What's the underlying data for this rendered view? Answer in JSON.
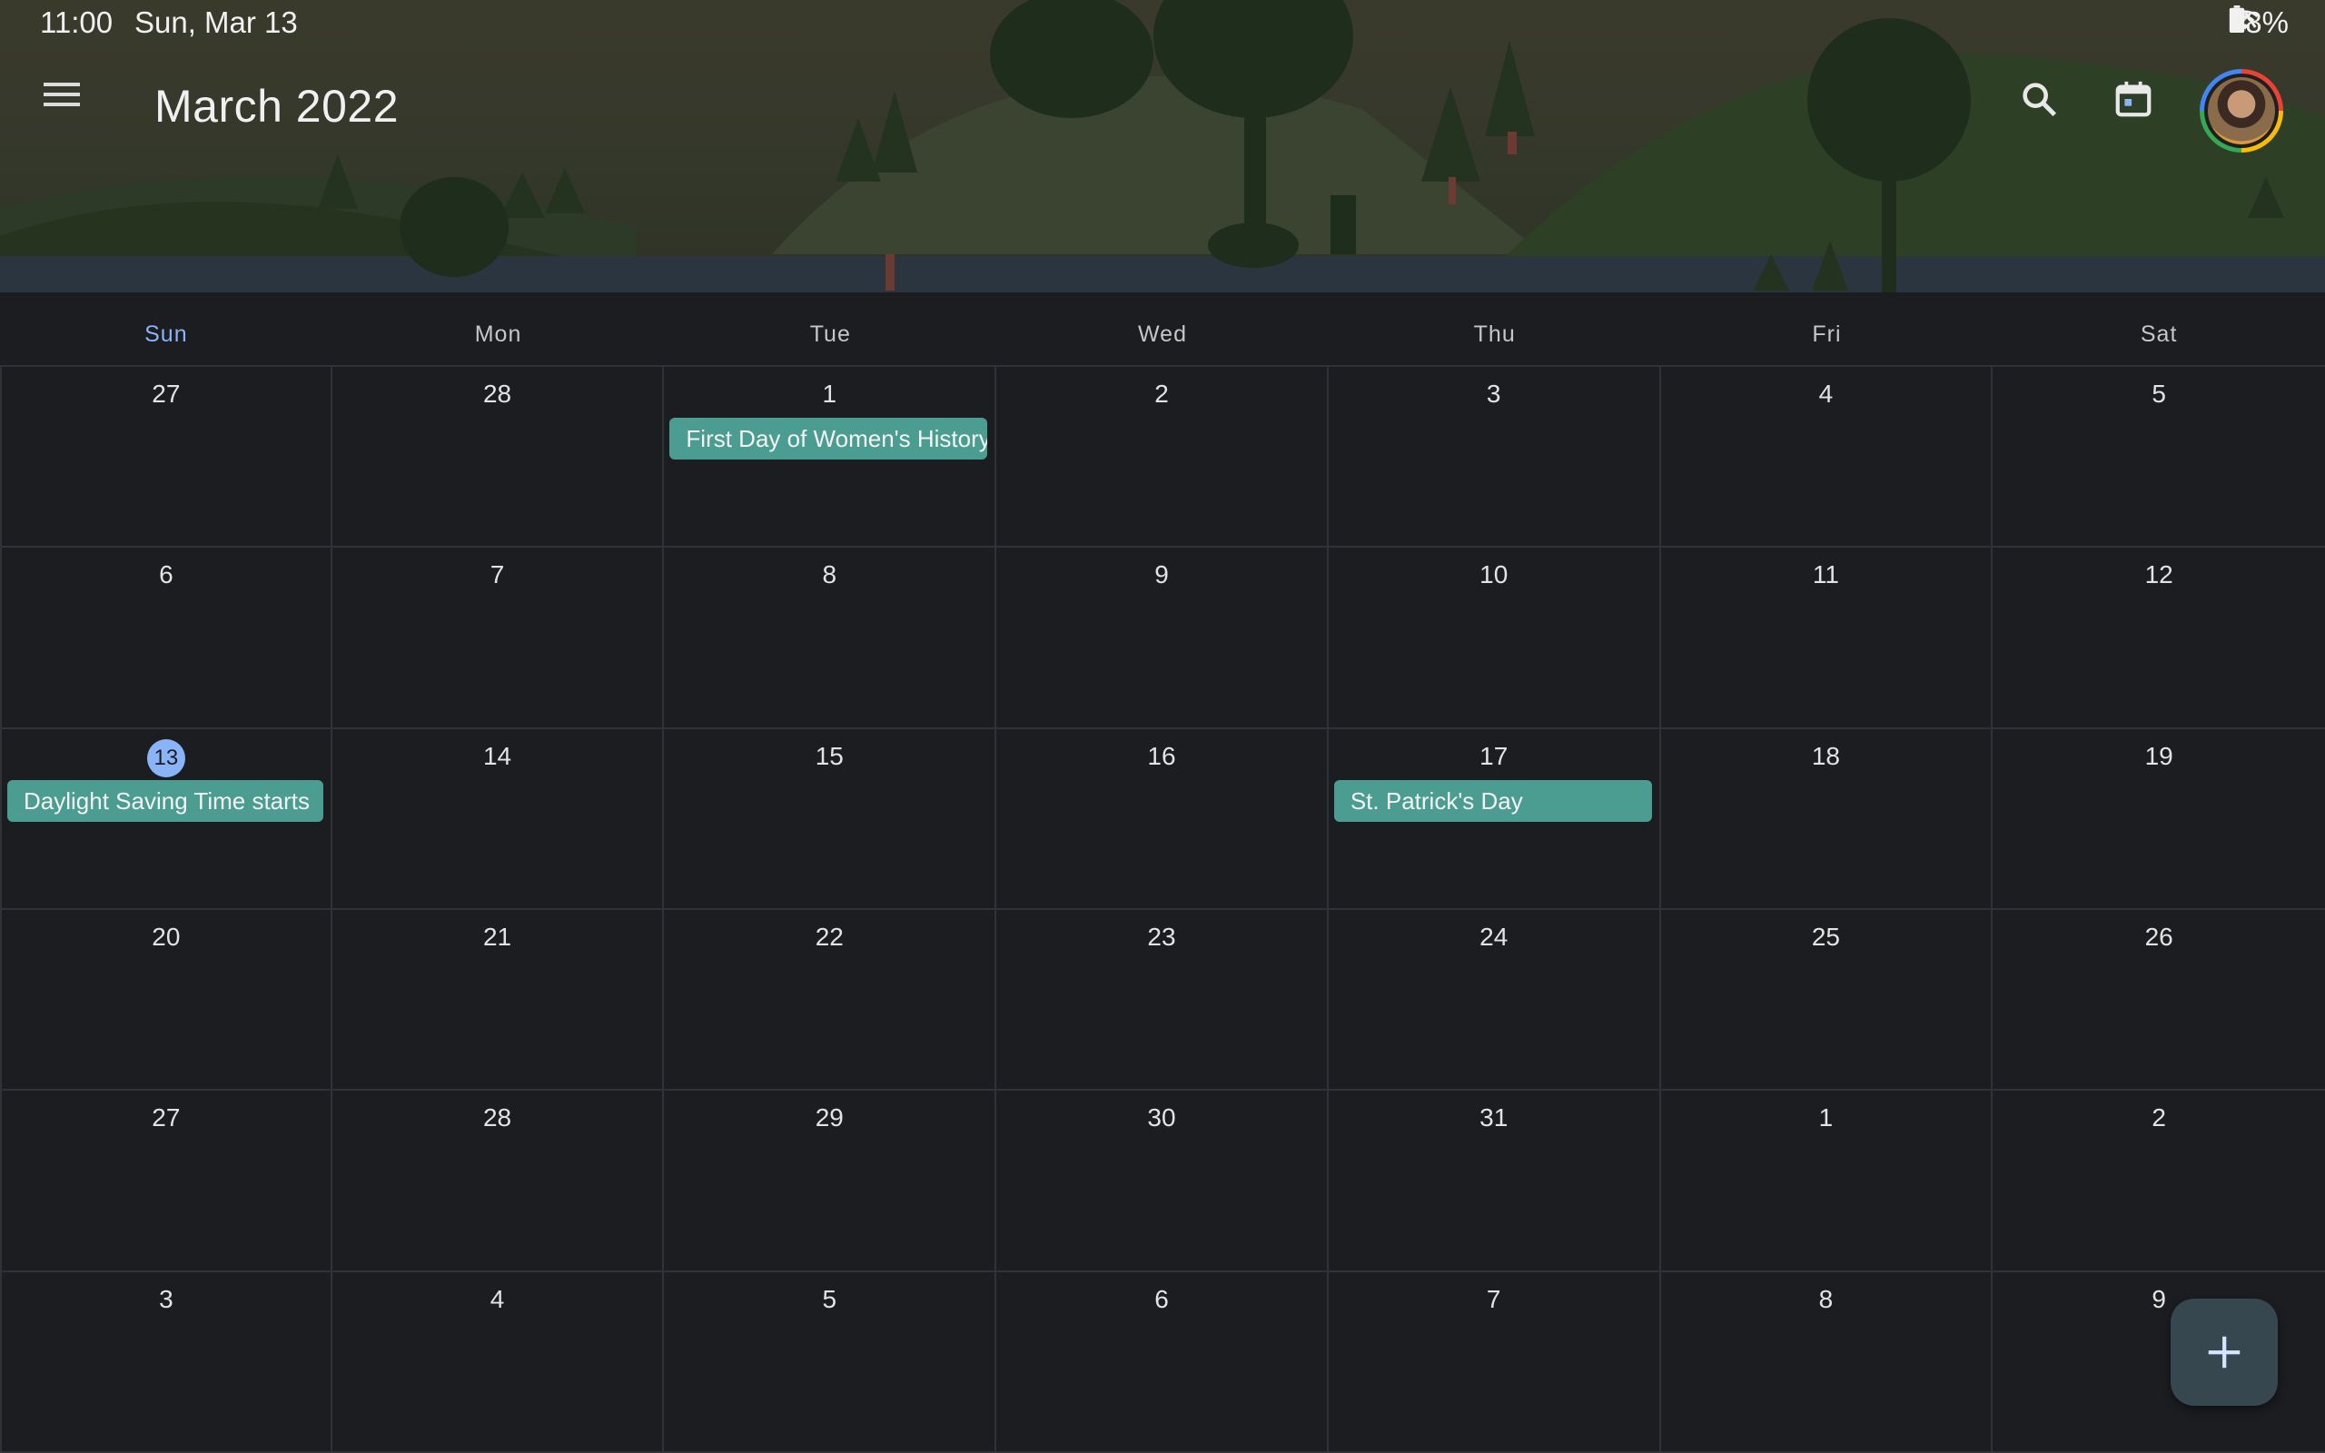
{
  "status_bar": {
    "time": "11:00",
    "date": "Sun, Mar 13",
    "battery": "78%",
    "icons": [
      "pen-icon",
      "mute-icon",
      "wifi-icon",
      "battery-icon"
    ]
  },
  "app_bar": {
    "title": "March 2022",
    "icons": [
      "menu-icon",
      "search-icon",
      "calendar-today-icon",
      "account-avatar"
    ]
  },
  "weekdays": [
    {
      "label": "Sun",
      "is_today": true
    },
    {
      "label": "Mon",
      "is_today": false
    },
    {
      "label": "Tue",
      "is_today": false
    },
    {
      "label": "Wed",
      "is_today": false
    },
    {
      "label": "Thu",
      "is_today": false
    },
    {
      "label": "Fri",
      "is_today": false
    },
    {
      "label": "Sat",
      "is_today": false
    }
  ],
  "weeks": [
    [
      {
        "day": "27",
        "events": []
      },
      {
        "day": "28",
        "events": []
      },
      {
        "day": "1",
        "events": [
          "First Day of Women's History Month"
        ]
      },
      {
        "day": "2",
        "events": []
      },
      {
        "day": "3",
        "events": []
      },
      {
        "day": "4",
        "events": []
      },
      {
        "day": "5",
        "events": []
      }
    ],
    [
      {
        "day": "6",
        "events": []
      },
      {
        "day": "7",
        "events": []
      },
      {
        "day": "8",
        "events": []
      },
      {
        "day": "9",
        "events": []
      },
      {
        "day": "10",
        "events": []
      },
      {
        "day": "11",
        "events": []
      },
      {
        "day": "12",
        "events": []
      }
    ],
    [
      {
        "day": "13",
        "events": [
          "Daylight Saving Time starts"
        ],
        "is_today": true
      },
      {
        "day": "14",
        "events": []
      },
      {
        "day": "15",
        "events": []
      },
      {
        "day": "16",
        "events": []
      },
      {
        "day": "17",
        "events": [
          "St. Patrick's Day"
        ]
      },
      {
        "day": "18",
        "events": []
      },
      {
        "day": "19",
        "events": []
      }
    ],
    [
      {
        "day": "20",
        "events": []
      },
      {
        "day": "21",
        "events": []
      },
      {
        "day": "22",
        "events": []
      },
      {
        "day": "23",
        "events": []
      },
      {
        "day": "24",
        "events": []
      },
      {
        "day": "25",
        "events": []
      },
      {
        "day": "26",
        "events": []
      }
    ],
    [
      {
        "day": "27",
        "events": []
      },
      {
        "day": "28",
        "events": []
      },
      {
        "day": "29",
        "events": []
      },
      {
        "day": "30",
        "events": []
      },
      {
        "day": "31",
        "events": []
      },
      {
        "day": "1",
        "events": []
      },
      {
        "day": "2",
        "events": []
      }
    ],
    [
      {
        "day": "3",
        "events": []
      },
      {
        "day": "4",
        "events": []
      },
      {
        "day": "5",
        "events": []
      },
      {
        "day": "6",
        "events": []
      },
      {
        "day": "7",
        "events": []
      },
      {
        "day": "8",
        "events": []
      },
      {
        "day": "9",
        "events": []
      }
    ]
  ],
  "fab": {
    "icon": "plus-icon"
  },
  "colors": {
    "background": "#1b1d20",
    "event_chip": "#4a9d90",
    "today_accent": "#8ab4f8",
    "grid_line": "#2f3236",
    "fab": "#36474f"
  }
}
